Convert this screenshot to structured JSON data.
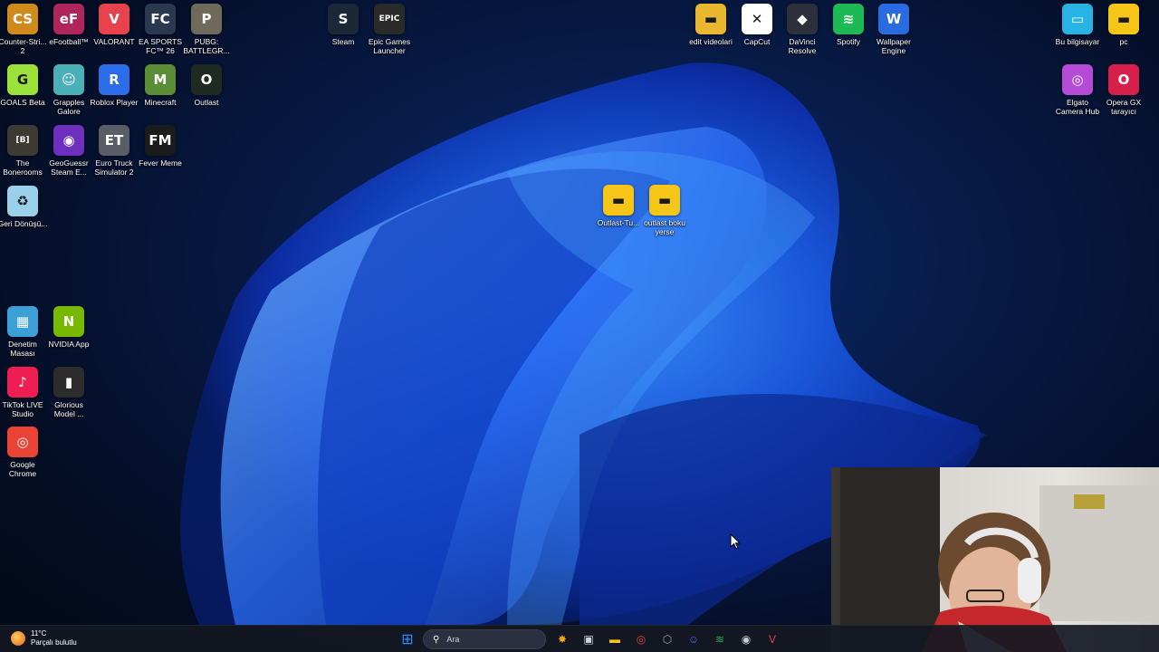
{
  "desktop": {
    "icons_left": [
      {
        "label": "Counter-Stri... 2",
        "color": "#d08a1c",
        "glyph": "CS"
      },
      {
        "label": "eFootball™",
        "color": "#b0265a",
        "glyph": "eF"
      },
      {
        "label": "VALORANT",
        "color": "#e8424c",
        "glyph": "V"
      },
      {
        "label": "EA SPORTS FC™ 26",
        "color": "#2a3950",
        "glyph": "FC"
      },
      {
        "label": "PUBG: BATTLEGR...",
        "color": "#6f6a5a",
        "glyph": "P"
      },
      {
        "label": "GOALS Beta",
        "color": "#9be13a",
        "glyph": "G"
      },
      {
        "label": "Grapples Galore",
        "color": "#4ab0b8",
        "glyph": "☺"
      },
      {
        "label": "Roblox Player",
        "color": "#2b6ce8",
        "glyph": "R"
      },
      {
        "label": "Minecraft",
        "color": "#5b8c36",
        "glyph": "M"
      },
      {
        "label": "Outlast",
        "color": "#1e2a22",
        "glyph": "O"
      },
      {
        "label": "The Bonerooms",
        "color": "#3d3a34",
        "glyph": "[B]"
      },
      {
        "label": "GeoGuessr Steam E...",
        "color": "#6e2fbf",
        "glyph": "◉"
      },
      {
        "label": "Euro Truck Simulator 2",
        "color": "#595e66",
        "glyph": "ET"
      },
      {
        "label": "Fever Meme",
        "color": "#1b1b1b",
        "glyph": "FM"
      },
      {
        "label": "Geri Dönüşü...",
        "color": "#9bd0ea",
        "glyph": "♻"
      },
      {
        "label": "Denetim Masası",
        "color": "#3aa0d6",
        "glyph": "▦"
      },
      {
        "label": "NVIDIA App",
        "color": "#76b900",
        "glyph": "N"
      },
      {
        "label": "TikTok LIVE Studio",
        "color": "#ee1d52",
        "glyph": "♪"
      },
      {
        "label": "Glorious Model ...",
        "color": "#2c2c2c",
        "glyph": "▮"
      },
      {
        "label": "Google Chrome",
        "color": "#ea4335",
        "glyph": "◎"
      }
    ],
    "icons_top": [
      {
        "label": "Steam",
        "color": "#1b2838",
        "glyph": "S"
      },
      {
        "label": "Epic Games Launcher",
        "color": "#2a2a2a",
        "glyph": "EPIC"
      },
      {
        "label": "edit videolari",
        "color": "#e9b730",
        "glyph": "▬"
      },
      {
        "label": "CapCut",
        "color": "#ffffff",
        "glyph": "✕"
      },
      {
        "label": "DaVinci Resolve",
        "color": "#2d2f3a",
        "glyph": "◆"
      },
      {
        "label": "Spotify",
        "color": "#1db954",
        "glyph": "≋"
      },
      {
        "label": "Wallpaper Engine",
        "color": "#2a6be0",
        "glyph": "W"
      }
    ],
    "icons_right": [
      {
        "label": "Bu bilgisayar",
        "color": "#27b4e4",
        "glyph": "▭"
      },
      {
        "label": "pc",
        "color": "#f5c518",
        "glyph": "▬"
      },
      {
        "label": "Elgato Camera Hub",
        "color": "#b44ad6",
        "glyph": "◎"
      },
      {
        "label": "Opera GX tarayıcı",
        "color": "#d61f4b",
        "glyph": "O"
      }
    ],
    "icons_center": [
      {
        "label": "Outlast-Tu...",
        "color": "#f5c518",
        "glyph": "▬"
      },
      {
        "label": "outlast boku yerse",
        "color": "#f5c518",
        "glyph": "▬"
      }
    ]
  },
  "taskbar": {
    "weather_temp": "11°C",
    "weather_desc": "Parçalı bulutlu",
    "search_placeholder": "Ara",
    "apps": [
      {
        "name": "start",
        "color": "#2d8cff",
        "glyph": "⊞"
      },
      {
        "name": "winamp",
        "color": "#f7a21b",
        "glyph": "✸"
      },
      {
        "name": "task-view",
        "color": "#cfd4de",
        "glyph": "▣"
      },
      {
        "name": "file-explorer",
        "color": "#f5c518",
        "glyph": "▬"
      },
      {
        "name": "chrome",
        "color": "#ea4335",
        "glyph": "◎"
      },
      {
        "name": "app-dark",
        "color": "#9aa0aa",
        "glyph": "⬡"
      },
      {
        "name": "discord",
        "color": "#5865f2",
        "glyph": "☺"
      },
      {
        "name": "spotify",
        "color": "#1db954",
        "glyph": "≋"
      },
      {
        "name": "obs",
        "color": "#c8ccd4",
        "glyph": "◉"
      },
      {
        "name": "valorant",
        "color": "#e8424c",
        "glyph": "V"
      }
    ]
  }
}
